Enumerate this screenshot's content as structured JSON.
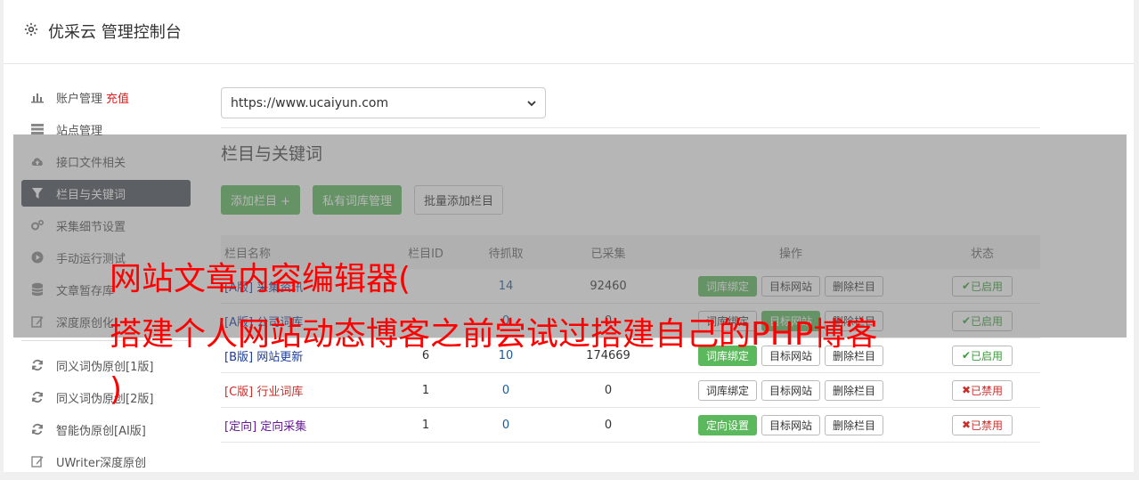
{
  "header": {
    "title": "优采云 管理控制台",
    "icon": "gear-icon"
  },
  "sidebar": {
    "items": [
      {
        "label": "账户管理",
        "extra": "充值",
        "icon": "bar-chart-icon"
      },
      {
        "label": "站点管理",
        "icon": "server-icon"
      },
      {
        "label": "接口文件相关",
        "icon": "cloud-upload-icon"
      },
      {
        "label": "栏目与关键词",
        "icon": "filter-icon",
        "active": true
      },
      {
        "label": "采集细节设置",
        "icon": "cogs-icon"
      },
      {
        "label": "手动运行测试",
        "icon": "play-circle-icon"
      },
      {
        "label": "文章暂存库",
        "icon": "database-icon"
      },
      {
        "label": "深度原创化",
        "icon": "edit-icon"
      }
    ],
    "items2": [
      {
        "label": "同义词伪原创[1版]",
        "icon": "refresh-icon"
      },
      {
        "label": "同义词伪原创[2版]",
        "icon": "refresh-icon"
      },
      {
        "label": "智能伪原创[AI版]",
        "icon": "refresh-icon"
      },
      {
        "label": "UWriter深度原创",
        "icon": "edit-icon"
      }
    ]
  },
  "main": {
    "site_select": "https://www.ucaiyun.com",
    "section_title": "栏目与关键词",
    "buttons": {
      "add": "添加栏目 +",
      "private": "私有词库管理",
      "batch": "批量添加栏目"
    },
    "table": {
      "headers": {
        "name": "栏目名称",
        "id": "栏目ID",
        "wait": "待抓取",
        "got": "已采集",
        "ops": "操作",
        "state": "状态"
      },
      "rows": [
        {
          "tag": "[A版]",
          "name": "采集资讯",
          "id": "",
          "wait": "14",
          "got": "92460",
          "op1": "词库绑定",
          "op2": "目标网站",
          "op3": "删除栏目",
          "state": "已启用"
        },
        {
          "tag": "[A版]",
          "name": "公司词库",
          "id": "",
          "wait": "0",
          "got": "0",
          "op1": "词库绑定",
          "op2": "目标网站",
          "op3": "删除栏目",
          "state": "已启用"
        },
        {
          "tag": "[B版]",
          "name": "网站更新",
          "id": "6",
          "wait": "10",
          "got": "174669",
          "op1": "词库绑定",
          "op2": "目标网站",
          "op3": "删除栏目",
          "state": "已启用"
        },
        {
          "tag": "[C版]",
          "name": "行业词库",
          "id": "1",
          "wait": "0",
          "got": "0",
          "op1": "词库绑定",
          "op2": "目标网站",
          "op3": "删除栏目",
          "state": "已禁用"
        },
        {
          "tag": "[定向]",
          "name": "定向采集",
          "id": "1",
          "wait": "0",
          "got": "0",
          "op1": "定向设置",
          "op2": "目标网站",
          "op3": "删除栏目",
          "state": "已禁用"
        }
      ]
    }
  },
  "overlay": {
    "line1": "网站文章内容编辑器(",
    "line2": "搭建个人网站动态博客之前尝试过搭建自己的PHP博客",
    "line3": ")"
  },
  "colors": {
    "green": "#5cb85c",
    "active_bg": "#4a5159",
    "red": "#ff0000"
  }
}
